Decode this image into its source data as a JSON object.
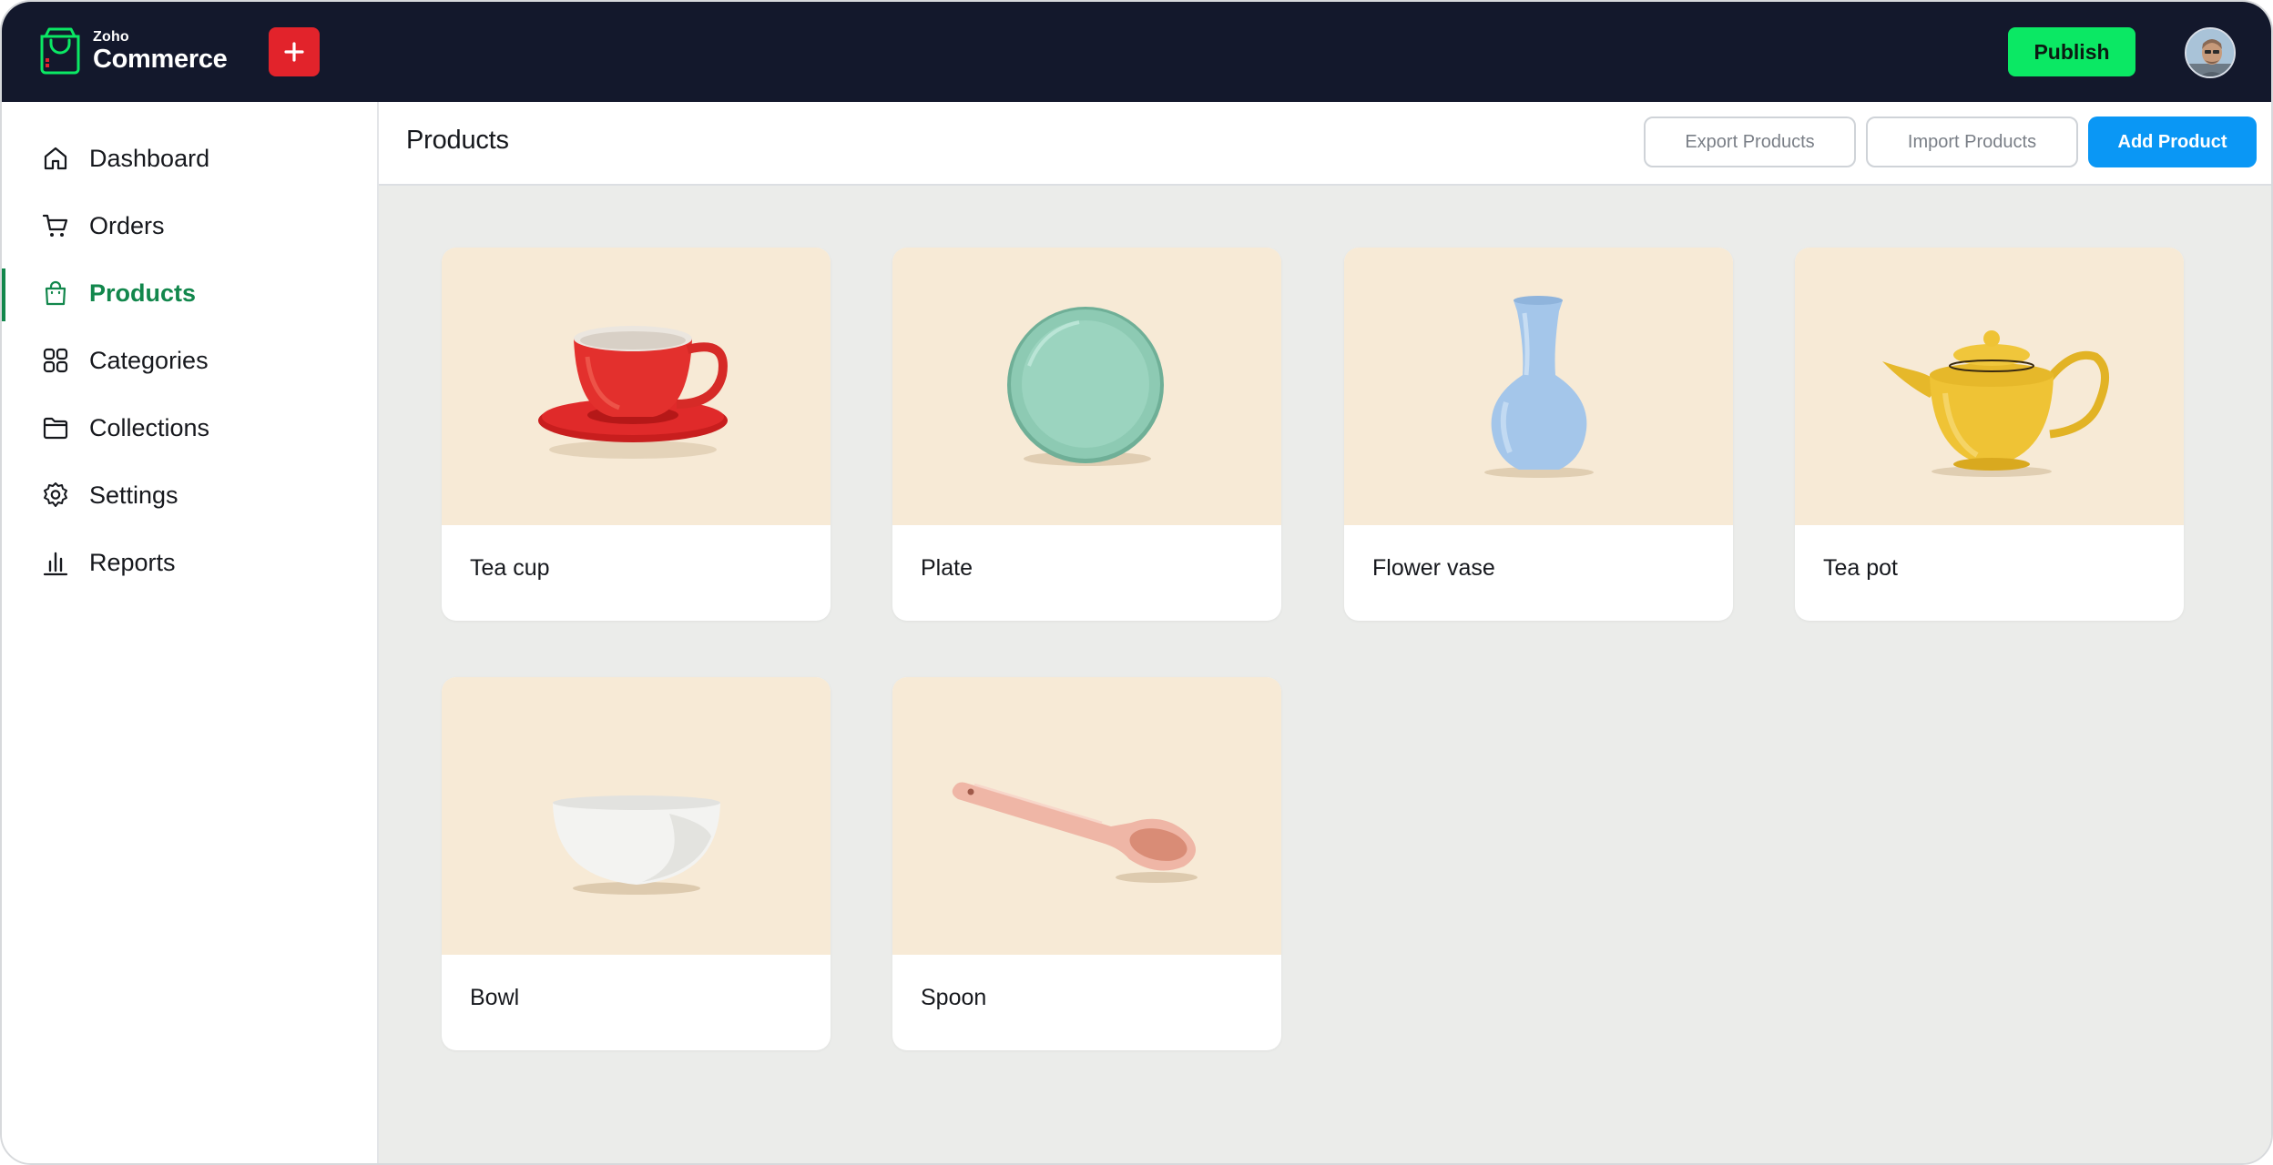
{
  "brand": {
    "zoho": "Zoho",
    "commerce": "Commerce",
    "accent": "#0be864"
  },
  "topbar": {
    "publish_label": "Publish",
    "plus_icon": "plus-icon",
    "avatar": "user-avatar"
  },
  "sidebar": {
    "items": [
      {
        "label": "Dashboard",
        "icon": "home-icon",
        "active": false
      },
      {
        "label": "Orders",
        "icon": "cart-icon",
        "active": false
      },
      {
        "label": "Products",
        "icon": "shopping-bag-icon",
        "active": true
      },
      {
        "label": "Categories",
        "icon": "grid-icon",
        "active": false
      },
      {
        "label": "Collections",
        "icon": "folder-icon",
        "active": false
      },
      {
        "label": "Settings",
        "icon": "gear-icon",
        "active": false
      },
      {
        "label": "Reports",
        "icon": "bar-chart-icon",
        "active": false
      }
    ],
    "active_color": "#12874c"
  },
  "header": {
    "title": "Products",
    "export_label": "Export Products",
    "import_label": "Import Products",
    "add_label": "Add Product"
  },
  "products": [
    {
      "name": "Tea cup",
      "image": "red-teacup"
    },
    {
      "name": "Plate",
      "image": "green-plate"
    },
    {
      "name": "Flower vase",
      "image": "blue-vase"
    },
    {
      "name": "Tea pot",
      "image": "yellow-teapot"
    },
    {
      "name": "Bowl",
      "image": "white-bowl"
    },
    {
      "name": "Spoon",
      "image": "pink-spoon"
    }
  ]
}
